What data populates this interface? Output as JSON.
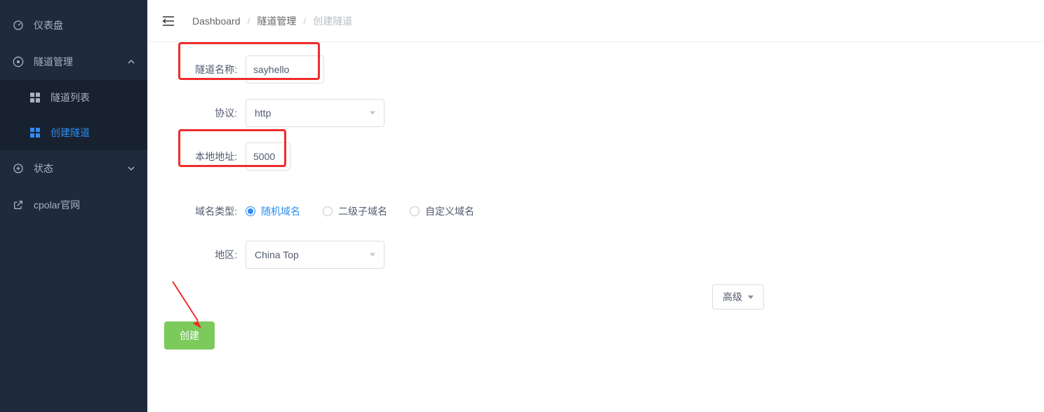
{
  "sidebar": {
    "items": [
      {
        "label": "仪表盘"
      },
      {
        "label": "隧道管理"
      },
      {
        "label": "状态"
      },
      {
        "label": "cpolar官网"
      }
    ],
    "subitems": [
      {
        "label": "隧道列表"
      },
      {
        "label": "创建隧道"
      }
    ]
  },
  "breadcrumb": {
    "items": [
      "Dashboard",
      "隧道管理",
      "创建隧道"
    ],
    "sep": "/"
  },
  "form": {
    "tunnel_name_label": "隧道名称:",
    "tunnel_name_value": "sayhello",
    "protocol_label": "协议:",
    "protocol_value": "http",
    "local_addr_label": "本地地址:",
    "local_addr_value": "5000",
    "domain_type_label": "域名类型:",
    "domain_type_options": [
      "随机域名",
      "二级子域名",
      "自定义域名"
    ],
    "domain_type_selected": 0,
    "region_label": "地区:",
    "region_value": "China Top",
    "advanced_label": "高级",
    "create_label": "创建"
  },
  "colors": {
    "accent": "#2d8cf0",
    "sidebar_bg": "#1f2a3c",
    "create_btn": "#7bca5b",
    "highlight": "#f02c2c"
  }
}
